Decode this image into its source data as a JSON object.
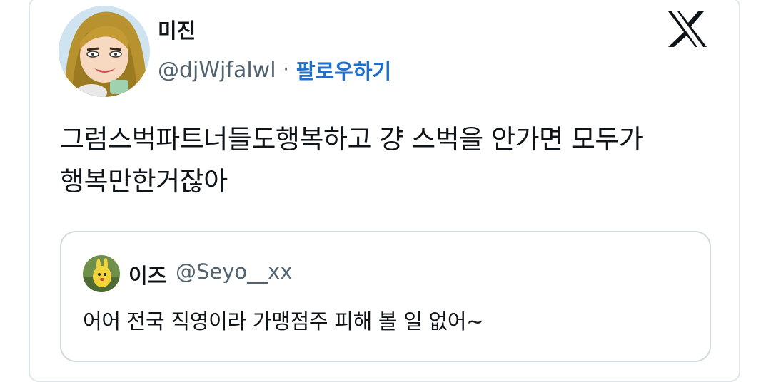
{
  "tweet": {
    "author": {
      "display_name": "미진",
      "handle": "@djWjfalwl",
      "separator": "·",
      "follow_label": "팔로우하기"
    },
    "text": "그럼스벅파트너들도행복하고 걍 스벅을 안가면 모두가 행복만한거잖아",
    "logo_icon": "x-logo-icon"
  },
  "quote": {
    "author": {
      "display_name": "이즈",
      "handle": "@Seyo__xx"
    },
    "text": "어어 전국 직영이라 가맹점주 피해 볼 일 없어~"
  },
  "colors": {
    "link": "#1d6fd0",
    "secondary_text": "#536471",
    "primary_text": "#0f1419",
    "border": "#cfd9de"
  }
}
